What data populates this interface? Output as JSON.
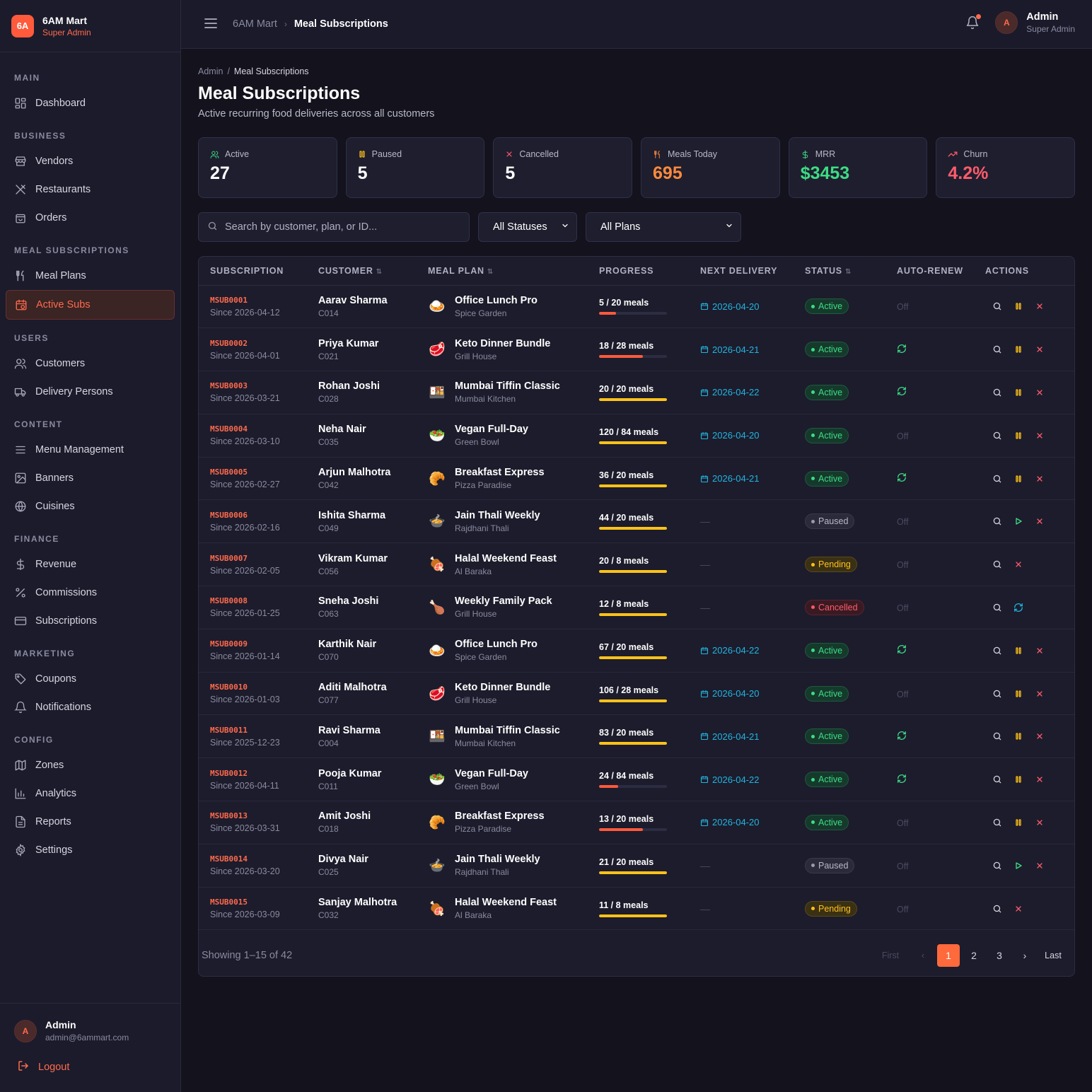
{
  "brand": {
    "logo": "6A",
    "name": "6AM Mart",
    "role": "Super Admin"
  },
  "nav": [
    {
      "section": "MAIN",
      "items": [
        {
          "label": "Dashboard",
          "icon": "dashboard-icon"
        }
      ]
    },
    {
      "section": "BUSINESS",
      "items": [
        {
          "label": "Vendors",
          "icon": "store-icon"
        },
        {
          "label": "Restaurants",
          "icon": "utensils-icon"
        },
        {
          "label": "Orders",
          "icon": "bag-icon"
        }
      ]
    },
    {
      "section": "MEAL SUBSCRIPTIONS",
      "items": [
        {
          "label": "Meal Plans",
          "icon": "fork-knife-icon"
        },
        {
          "label": "Active Subs",
          "icon": "calendar-clock-icon",
          "active": true
        }
      ]
    },
    {
      "section": "USERS",
      "items": [
        {
          "label": "Customers",
          "icon": "users-icon"
        },
        {
          "label": "Delivery Persons",
          "icon": "truck-icon"
        }
      ]
    },
    {
      "section": "CONTENT",
      "items": [
        {
          "label": "Menu Management",
          "icon": "menu-icon"
        },
        {
          "label": "Banners",
          "icon": "image-icon"
        },
        {
          "label": "Cuisines",
          "icon": "globe-icon"
        }
      ]
    },
    {
      "section": "FINANCE",
      "items": [
        {
          "label": "Revenue",
          "icon": "dollar-icon"
        },
        {
          "label": "Commissions",
          "icon": "percent-icon"
        },
        {
          "label": "Subscriptions",
          "icon": "card-icon"
        }
      ]
    },
    {
      "section": "MARKETING",
      "items": [
        {
          "label": "Coupons",
          "icon": "tag-icon"
        },
        {
          "label": "Notifications",
          "icon": "bell-icon"
        }
      ]
    },
    {
      "section": "CONFIG",
      "items": [
        {
          "label": "Zones",
          "icon": "map-icon"
        },
        {
          "label": "Analytics",
          "icon": "chart-icon"
        },
        {
          "label": "Reports",
          "icon": "file-icon"
        },
        {
          "label": "Settings",
          "icon": "gear-icon"
        }
      ]
    }
  ],
  "sidebar_footer": {
    "avatar": "A",
    "name": "Admin",
    "email": "admin@6ammart.com",
    "logout": "Logout"
  },
  "topbar": {
    "crumb_root": "6AM Mart",
    "crumb_current": "Meal Subscriptions",
    "avatar": "A",
    "user_name": "Admin",
    "user_role": "Super Admin"
  },
  "page": {
    "crumb_root": "Admin",
    "crumb_sep": "/",
    "crumb_current": "Meal Subscriptions",
    "title": "Meal Subscriptions",
    "subtitle": "Active recurring food deliveries across all customers"
  },
  "stats": [
    {
      "label": "Active",
      "value": "27",
      "icon": "users-icon",
      "icon_color": "#3ddc84",
      "value_color": "#ffffff"
    },
    {
      "label": "Paused",
      "value": "5",
      "icon": "pause-icon",
      "icon_color": "#ffc21a",
      "value_color": "#ffffff"
    },
    {
      "label": "Cancelled",
      "value": "5",
      "icon": "x-icon",
      "icon_color": "#ff5b6b",
      "value_color": "#ffffff"
    },
    {
      "label": "Meals Today",
      "value": "695",
      "icon": "fork-knife-icon",
      "icon_color": "#ff8a3c",
      "value_color": "#ff8a3c"
    },
    {
      "label": "MRR",
      "value": "$3453",
      "icon": "dollar-icon",
      "icon_color": "#3ddc84",
      "value_color": "#3ddc84"
    },
    {
      "label": "Churn",
      "value": "4.2%",
      "icon": "trend-icon",
      "icon_color": "#ff5b6b",
      "value_color": "#ff5b6b"
    }
  ],
  "filters": {
    "search_placeholder": "Search by customer, plan, or ID...",
    "status_selected": "All Statuses",
    "plan_selected": "All Plans"
  },
  "table": {
    "headers": [
      "SUBSCRIPTION",
      "CUSTOMER",
      "MEAL PLAN",
      "PROGRESS",
      "NEXT DELIVERY",
      "STATUS",
      "AUTO-RENEW",
      "ACTIONS"
    ],
    "rows": [
      {
        "id": "MSUB0001",
        "since": "Since 2026-04-12",
        "customer": "Aarav Sharma",
        "cid": "C014",
        "plan": "Office Lunch Pro",
        "vendor": "Spice Garden",
        "plan_icon": "🍛",
        "progress": "5 / 20 meals",
        "done": 5,
        "total": 20,
        "next": "2026-04-20",
        "status": "Active",
        "renew": "Off"
      },
      {
        "id": "MSUB0002",
        "since": "Since 2026-04-01",
        "customer": "Priya Kumar",
        "cid": "C021",
        "plan": "Keto Dinner Bundle",
        "vendor": "Grill House",
        "plan_icon": "🥩",
        "progress": "18 / 28 meals",
        "done": 18,
        "total": 28,
        "next": "2026-04-21",
        "status": "Active",
        "renew": "On"
      },
      {
        "id": "MSUB0003",
        "since": "Since 2026-03-21",
        "customer": "Rohan Joshi",
        "cid": "C028",
        "plan": "Mumbai Tiffin Classic",
        "vendor": "Mumbai Kitchen",
        "plan_icon": "🍱",
        "progress": "20 / 20 meals",
        "done": 20,
        "total": 20,
        "next": "2026-04-22",
        "status": "Active",
        "renew": "On"
      },
      {
        "id": "MSUB0004",
        "since": "Since 2026-03-10",
        "customer": "Neha Nair",
        "cid": "C035",
        "plan": "Vegan Full-Day",
        "vendor": "Green Bowl",
        "plan_icon": "🥗",
        "progress": "120 / 84 meals",
        "done": 120,
        "total": 84,
        "next": "2026-04-20",
        "status": "Active",
        "renew": "Off"
      },
      {
        "id": "MSUB0005",
        "since": "Since 2026-02-27",
        "customer": "Arjun Malhotra",
        "cid": "C042",
        "plan": "Breakfast Express",
        "vendor": "Pizza Paradise",
        "plan_icon": "🥐",
        "progress": "36 / 20 meals",
        "done": 36,
        "total": 20,
        "next": "2026-04-21",
        "status": "Active",
        "renew": "On"
      },
      {
        "id": "MSUB0006",
        "since": "Since 2026-02-16",
        "customer": "Ishita Sharma",
        "cid": "C049",
        "plan": "Jain Thali Weekly",
        "vendor": "Rajdhani Thali",
        "plan_icon": "🍲",
        "progress": "44 / 20 meals",
        "done": 44,
        "total": 20,
        "next": "—",
        "status": "Paused",
        "renew": "Off"
      },
      {
        "id": "MSUB0007",
        "since": "Since 2026-02-05",
        "customer": "Vikram Kumar",
        "cid": "C056",
        "plan": "Halal Weekend Feast",
        "vendor": "Al Baraka",
        "plan_icon": "🍖",
        "progress": "20 / 8 meals",
        "done": 20,
        "total": 8,
        "next": "—",
        "status": "Pending",
        "renew": "Off"
      },
      {
        "id": "MSUB0008",
        "since": "Since 2026-01-25",
        "customer": "Sneha Joshi",
        "cid": "C063",
        "plan": "Weekly Family Pack",
        "vendor": "Grill House",
        "plan_icon": "🍗",
        "progress": "12 / 8 meals",
        "done": 12,
        "total": 8,
        "next": "—",
        "status": "Cancelled",
        "renew": "Off"
      },
      {
        "id": "MSUB0009",
        "since": "Since 2026-01-14",
        "customer": "Karthik Nair",
        "cid": "C070",
        "plan": "Office Lunch Pro",
        "vendor": "Spice Garden",
        "plan_icon": "🍛",
        "progress": "67 / 20 meals",
        "done": 67,
        "total": 20,
        "next": "2026-04-22",
        "status": "Active",
        "renew": "On"
      },
      {
        "id": "MSUB0010",
        "since": "Since 2026-01-03",
        "customer": "Aditi Malhotra",
        "cid": "C077",
        "plan": "Keto Dinner Bundle",
        "vendor": "Grill House",
        "plan_icon": "🥩",
        "progress": "106 / 28 meals",
        "done": 106,
        "total": 28,
        "next": "2026-04-20",
        "status": "Active",
        "renew": "Off"
      },
      {
        "id": "MSUB0011",
        "since": "Since 2025-12-23",
        "customer": "Ravi Sharma",
        "cid": "C004",
        "plan": "Mumbai Tiffin Classic",
        "vendor": "Mumbai Kitchen",
        "plan_icon": "🍱",
        "progress": "83 / 20 meals",
        "done": 83,
        "total": 20,
        "next": "2026-04-21",
        "status": "Active",
        "renew": "On"
      },
      {
        "id": "MSUB0012",
        "since": "Since 2026-04-11",
        "customer": "Pooja Kumar",
        "cid": "C011",
        "plan": "Vegan Full-Day",
        "vendor": "Green Bowl",
        "plan_icon": "🥗",
        "progress": "24 / 84 meals",
        "done": 24,
        "total": 84,
        "next": "2026-04-22",
        "status": "Active",
        "renew": "On"
      },
      {
        "id": "MSUB0013",
        "since": "Since 2026-03-31",
        "customer": "Amit Joshi",
        "cid": "C018",
        "plan": "Breakfast Express",
        "vendor": "Pizza Paradise",
        "plan_icon": "🥐",
        "progress": "13 / 20 meals",
        "done": 13,
        "total": 20,
        "next": "2026-04-20",
        "status": "Active",
        "renew": "Off"
      },
      {
        "id": "MSUB0014",
        "since": "Since 2026-03-20",
        "customer": "Divya Nair",
        "cid": "C025",
        "plan": "Jain Thali Weekly",
        "vendor": "Rajdhani Thali",
        "plan_icon": "🍲",
        "progress": "21 / 20 meals",
        "done": 21,
        "total": 20,
        "next": "—",
        "status": "Paused",
        "renew": "Off"
      },
      {
        "id": "MSUB0015",
        "since": "Since 2026-03-09",
        "customer": "Sanjay Malhotra",
        "cid": "C032",
        "plan": "Halal Weekend Feast",
        "vendor": "Al Baraka",
        "plan_icon": "🍖",
        "progress": "11 / 8 meals",
        "done": 11,
        "total": 8,
        "next": "—",
        "status": "Pending",
        "renew": "Off"
      }
    ]
  },
  "pagination": {
    "showing": "Showing 1–15 of 42",
    "first": "First",
    "prev": "‹",
    "pages": [
      "1",
      "2",
      "3"
    ],
    "current": "1",
    "next": "›",
    "last": "Last"
  },
  "colors": {
    "accent": "#ff6a3c",
    "active": "#3ddc84",
    "paused": "#b8b8c8",
    "pending": "#ffc21a",
    "cancelled": "#ff5b6b",
    "link": "#22b5e0"
  }
}
